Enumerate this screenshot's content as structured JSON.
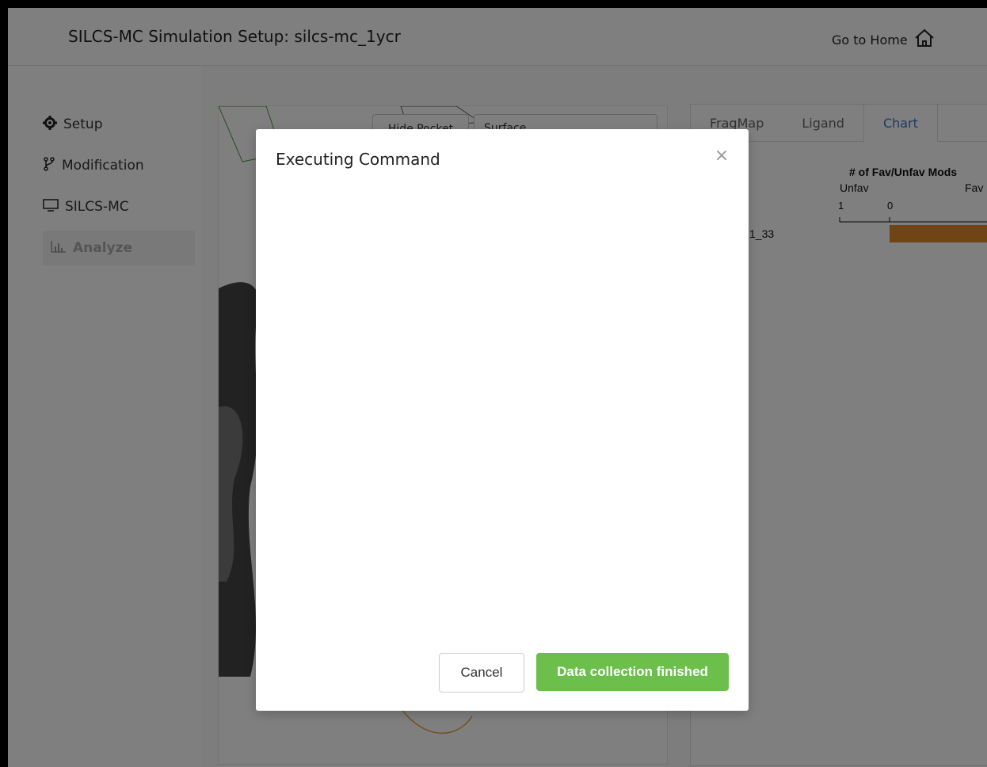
{
  "header": {
    "title": "SILCS-MC Simulation Setup: silcs-mc_1ycr",
    "home_label": "Go to Home"
  },
  "sidebar": {
    "items": [
      {
        "label": "Setup",
        "icon": "gear-icon"
      },
      {
        "label": "Modification",
        "icon": "branch-icon"
      },
      {
        "label": "SILCS-MC",
        "icon": "monitor-icon"
      },
      {
        "label": "Analyze",
        "icon": "bar-chart-icon",
        "active": true
      }
    ]
  },
  "viewer": {
    "hide_pocket_label": "Hide Pocket",
    "representation_value": "Surface"
  },
  "right_panel": {
    "tabs": [
      "FragMap",
      "Ligand",
      "Chart"
    ],
    "active_tab": "Chart",
    "chart_title": "# of Fav/Unfav Mods",
    "unfav_label": "Unfav",
    "fav_label": "Fav",
    "tick_1": "1",
    "tick_0": "0",
    "row_label": "1_33"
  },
  "modal": {
    "title": "Executing Command",
    "close_symbol": "×",
    "cancel_label": "Cancel",
    "primary_label": "Data collection finished"
  },
  "colors": {
    "primary_button": "#6cbf4a",
    "active_tab": "#3a76c9",
    "bar": "#e08a2c"
  }
}
